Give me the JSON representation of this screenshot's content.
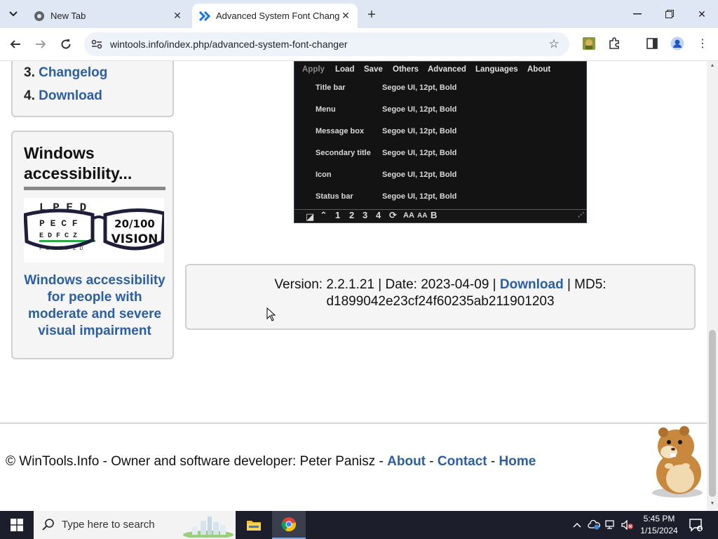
{
  "browser": {
    "tabs": [
      {
        "title": "New Tab",
        "active": false
      },
      {
        "title": "Advanced System Font Changer",
        "active": true
      }
    ],
    "url": "wintools.info/index.php/advanced-system-font-changer"
  },
  "sidebar": {
    "nav_items": [
      {
        "number": "3.",
        "label": "Changelog"
      },
      {
        "number": "4.",
        "label": "Download"
      }
    ],
    "promo": {
      "heading": "Windows accessibility...",
      "image_text": "20/100 VISION",
      "chart_rows": [
        "L P E D",
        "P E C F",
        "E D F C Z",
        "F E L O P Z D"
      ],
      "caption": "Windows accessibility for people with moderate and severe visual impairment"
    }
  },
  "app_screenshot": {
    "menu": [
      "Apply",
      "Load",
      "Save",
      "Others",
      "Advanced",
      "Languages",
      "About"
    ],
    "rows": [
      {
        "name": "Title bar",
        "value": "Segoe UI, 12pt, Bold"
      },
      {
        "name": "Menu",
        "value": "Segoe UI, 12pt, Bold"
      },
      {
        "name": "Message box",
        "value": "Segoe UI, 12pt, Bold"
      },
      {
        "name": "Secondary title",
        "value": "Segoe UI, 12pt, Bold"
      },
      {
        "name": "Icon",
        "value": "Segoe UI, 12pt, Bold"
      },
      {
        "name": "Status bar",
        "value": "Segoe UI, 12pt, Bold"
      }
    ],
    "bottom_buttons": [
      "1",
      "2",
      "3",
      "4",
      "AA",
      "AA",
      "B"
    ]
  },
  "version_info": {
    "prefix": "Version: 2.2.1.21 | Date: 2023-04-09 |",
    "download_label": "Download",
    "md5_label": "| MD5:",
    "md5": "d1899042e23cf24f60235ab211901203"
  },
  "footer": {
    "copyright": "© WinTools.Info - Owner and software developer: Peter Panisz -",
    "links": [
      "About",
      "Contact",
      "Home"
    ],
    "separator": "-"
  },
  "taskbar": {
    "search_placeholder": "Type here to search",
    "time": "5:45 PM",
    "date": "1/15/2024"
  },
  "colors": {
    "link": "#2c5ea3",
    "tabstrip": "#dfe7f5",
    "taskbar": "#1c1f2b"
  }
}
